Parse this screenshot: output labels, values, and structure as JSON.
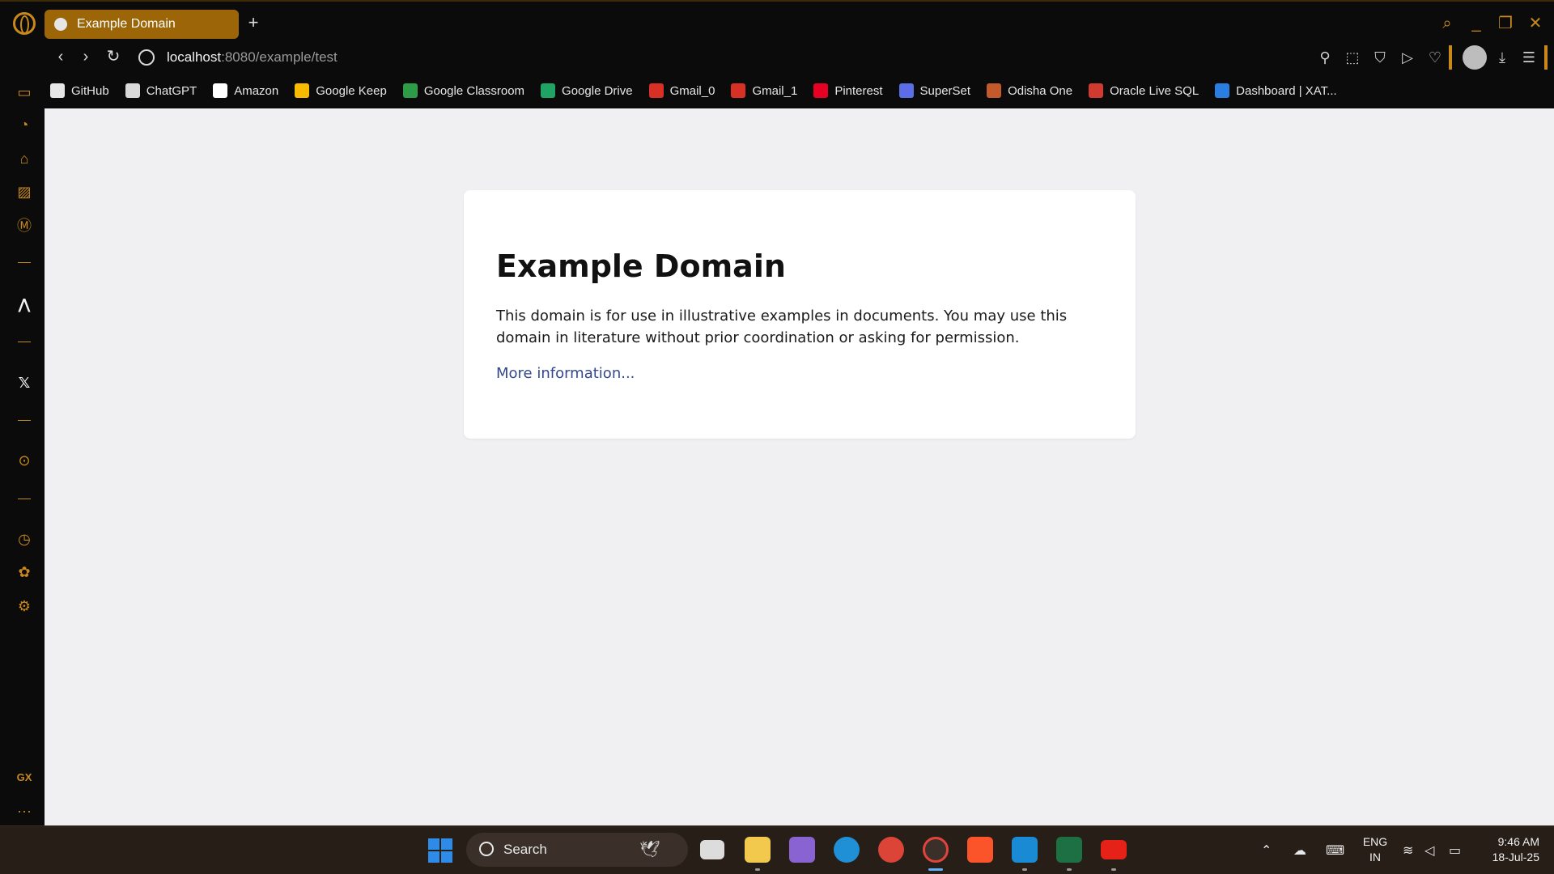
{
  "browser": {
    "tab": {
      "title": "Example Domain"
    },
    "url": {
      "host": "localhost",
      "rest": ":8080/example/test"
    }
  },
  "bookmarks": [
    {
      "label": "GitHub",
      "icon": "github-icon",
      "color": "#e6e6e6"
    },
    {
      "label": "ChatGPT",
      "icon": "chatgpt-icon",
      "color": "#d9d9d9"
    },
    {
      "label": "Amazon",
      "icon": "amazon-icon",
      "color": "#ffffff"
    },
    {
      "label": "Google Keep",
      "icon": "google-keep-icon",
      "color": "#f9bb00"
    },
    {
      "label": "Google Classroom",
      "icon": "google-classroom-icon",
      "color": "#2e9b46"
    },
    {
      "label": "Google Drive",
      "icon": "google-drive-icon",
      "color": "#1fa463"
    },
    {
      "label": "Gmail_0",
      "icon": "gmail-icon",
      "color": "#d93025"
    },
    {
      "label": "Gmail_1",
      "icon": "gmail-icon",
      "color": "#d93025"
    },
    {
      "label": "Pinterest",
      "icon": "pinterest-icon",
      "color": "#e60023"
    },
    {
      "label": "SuperSet",
      "icon": "superset-icon",
      "color": "#5b6ee8"
    },
    {
      "label": "Odisha One",
      "icon": "odisha-one-icon",
      "color": "#c45a2c"
    },
    {
      "label": "Oracle Live SQL",
      "icon": "oracle-icon",
      "color": "#d13b2f"
    },
    {
      "label": "Dashboard | XAT...",
      "icon": "dashboard-icon",
      "color": "#2a7de1"
    }
  ],
  "page": {
    "heading": "Example Domain",
    "paragraph": "This domain is for use in illustrative examples in documents. You may use this domain in literature without prior coordination or asking for permission.",
    "link": "More information..."
  },
  "sidebar": {
    "gx_label": "GX",
    "more_label": "···"
  },
  "taskbar": {
    "search_label": "Search",
    "lang_top": "ENG",
    "lang_bottom": "IN",
    "time": "9:46 AM",
    "date": "18-Jul-25"
  },
  "colors": {
    "accent": "#c8891a",
    "tab_active": "#9c6608",
    "link": "#34488c"
  }
}
